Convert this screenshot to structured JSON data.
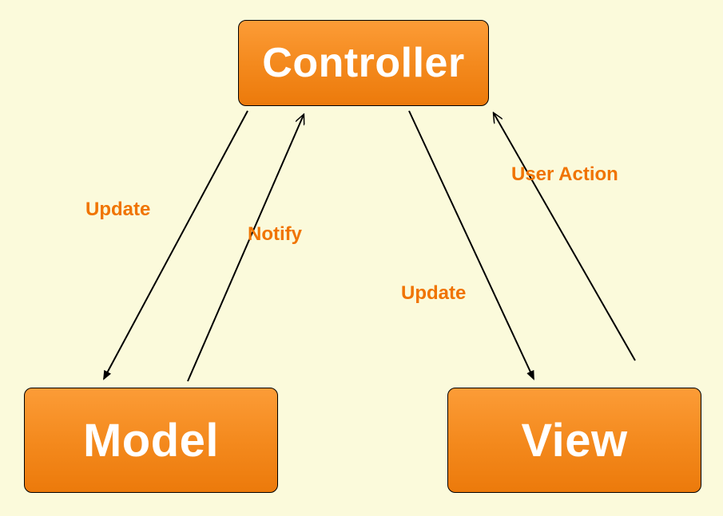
{
  "diagram": {
    "type": "mvc-pattern",
    "nodes": {
      "controller": {
        "label": "Controller"
      },
      "model": {
        "label": "Model"
      },
      "view": {
        "label": "View"
      }
    },
    "arrows": {
      "controller_to_model": {
        "label": "Update"
      },
      "model_to_controller": {
        "label": "Notify"
      },
      "controller_to_view": {
        "label": "Update"
      },
      "view_to_controller": {
        "label": "User Action"
      }
    },
    "colors": {
      "background": "#fbfadb",
      "node_fill_top": "#fc9c37",
      "node_fill_bottom": "#ec7a0b",
      "node_border": "#000000",
      "node_text": "#ffffff",
      "arrow": "#000000",
      "label_text": "#f07400"
    }
  }
}
